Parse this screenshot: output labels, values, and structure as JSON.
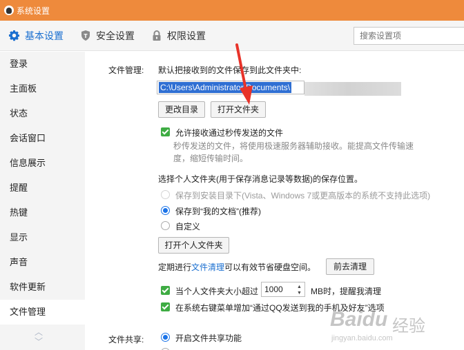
{
  "window": {
    "title": "系统设置"
  },
  "tabs": [
    {
      "label": "基本设置",
      "icon": "gear-icon",
      "active": true
    },
    {
      "label": "安全设置",
      "icon": "shield-icon"
    },
    {
      "label": "权限设置",
      "icon": "lock-icon"
    }
  ],
  "search": {
    "placeholder": "搜索设置项"
  },
  "sidebar": {
    "items": [
      "登录",
      "主面板",
      "状态",
      "会话窗口",
      "信息展示",
      "提醒",
      "热键",
      "显示",
      "声音",
      "软件更新",
      "文件管理"
    ],
    "active": "文件管理"
  },
  "file_management": {
    "section_label": "文件管理:",
    "description": "默认把接收到的文件保存到此文件夹中:",
    "path_value": "C:\\Users\\Administrator\\Documents\\",
    "change_dir_button": "更改目录",
    "open_folder_button": "打开文件夹",
    "allow_transfer_label": "允许接收通过秒传发送的文件",
    "allow_transfer_hint": "秒传发送的文件，将使用极速服务器辅助接收。能提高文件传输速度，缩短传输时间。",
    "personal_folder_title": "选择个人文件夹(用于保存消息记录等数据)的保存位置。",
    "radio_install_dir": "保存到安装目录下(Vista、Windows 7或更高版本的系统不支持此选项)",
    "radio_my_docs": "保存到“我的文档”(推荐)",
    "radio_custom": "自定义",
    "open_personal_folder_button": "打开个人文件夹",
    "cleanup_prefix": "定期进行",
    "cleanup_link": "文件清理",
    "cleanup_suffix": "可以有效节省硬盘空间。",
    "cleanup_button": "前去清理",
    "size_limit_prefix": "当个人文件夹大小超过",
    "size_limit_value": "1000",
    "size_limit_suffix": "MB时，提醒我清理",
    "context_menu_label": "在系统右键菜单增加“通过QQ发送到我的手机及好友”选项"
  },
  "file_sharing": {
    "section_label": "文件共享:",
    "enable_label": "开启文件共享功能"
  },
  "watermark": {
    "brand": "Baidu",
    "suffix": "经验",
    "url": "jingyan.baidu.com"
  },
  "colors": {
    "titlebar": "#ee8a3c",
    "accent": "#1a6fd0",
    "checkbox": "#3eac43",
    "annotation_arrow": "#e8332a"
  }
}
